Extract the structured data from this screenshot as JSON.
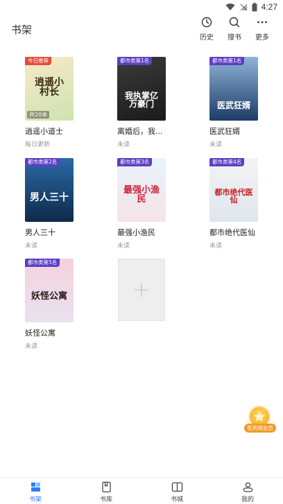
{
  "status_bar": {
    "time": "4:27"
  },
  "header": {
    "title": "书架",
    "actions": [
      {
        "label": "历史",
        "icon": "clock-icon"
      },
      {
        "label": "搜书",
        "icon": "search-icon"
      },
      {
        "label": "更多",
        "icon": "more-icon"
      }
    ]
  },
  "books": [
    {
      "title": "逍遥小道士",
      "status": "每日更新",
      "badge": "今日推荐",
      "badge_color": "#e64b3c",
      "count_tag": "共20本",
      "cover_text": "逍遥小村长",
      "cover_colors": [
        "#f7e9c8",
        "#cfe3b0"
      ],
      "cover_text_color": "#3a2a10"
    },
    {
      "title": "离婚后，我...",
      "status": "未读",
      "badge": "都市类第1名",
      "badge_color": "#5b3fc4",
      "cover_text": "我执掌亿万豪门",
      "cover_colors": [
        "#3b3b3b",
        "#1a1a1a"
      ],
      "cover_text_color": "#ffffff"
    },
    {
      "title": "医武狂婿",
      "status": "未读",
      "badge": "都市类第1名",
      "badge_color": "#5b3fc4",
      "cover_text": "医武狂婿",
      "cover_colors": [
        "#8fb4d8",
        "#1d3c66"
      ],
      "cover_text_color": "#ffffff"
    },
    {
      "title": "男人三十",
      "status": "未读",
      "badge": "都市类第2名",
      "badge_color": "#5b3fc4",
      "cover_text": "男人三十",
      "cover_colors": [
        "#2a6aa8",
        "#0f2a48"
      ],
      "cover_text_color": "#ffffff"
    },
    {
      "title": "最强小渔民",
      "status": "未读",
      "badge": "都市类第3名",
      "badge_color": "#5b3fc4",
      "cover_text": "最强小渔民",
      "cover_colors": [
        "#e8f3fb",
        "#f6e3e8"
      ],
      "cover_text_color": "#d0243c"
    },
    {
      "title": "都市绝代医仙",
      "status": "未读",
      "badge": "都市类第4名",
      "badge_color": "#5b3fc4",
      "cover_text": "都市绝代医仙",
      "cover_colors": [
        "#f3f3f3",
        "#dfe6ee"
      ],
      "cover_text_color": "#c81e1e"
    },
    {
      "title": "妖怪公寓",
      "status": "未读",
      "badge": "都市类第5名",
      "badge_color": "#5b3fc4",
      "cover_text": "妖怪公寓",
      "cover_colors": [
        "#f4d2dc",
        "#e9e1f0"
      ],
      "cover_text_color": "#2a1a1a"
    }
  ],
  "vip_float": {
    "label": "签到领会员"
  },
  "bottom_nav": [
    {
      "label": "书架",
      "icon": "bookshelf-icon",
      "active": true
    },
    {
      "label": "书库",
      "icon": "library-icon",
      "active": false
    },
    {
      "label": "书城",
      "icon": "open-book-icon",
      "active": false
    },
    {
      "label": "我的",
      "icon": "profile-icon",
      "active": false
    }
  ],
  "colors": {
    "accent": "#2f7cf6",
    "badge_red": "#e64b3c",
    "badge_purple": "#5b3fc4"
  }
}
